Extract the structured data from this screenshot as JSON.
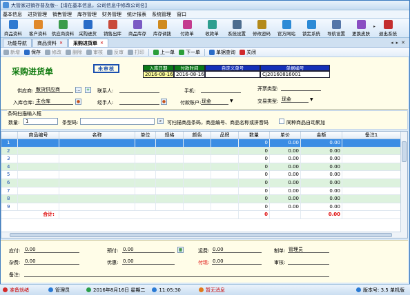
{
  "window": {
    "title": "大管家进销存普及版--【请在基本信息，公司信息中修改公司名】"
  },
  "menu": [
    "基本信息",
    "进货管理",
    "销售管理",
    "库存管理",
    "财务管理",
    "统计报表",
    "系统管理",
    "窗口"
  ],
  "toolbar": [
    {
      "label": "商品资料",
      "icon": "goods-icon",
      "color": "#2f7ad1"
    },
    {
      "label": "客户资料",
      "icon": "customer-icon",
      "color": "#e0892b"
    },
    {
      "label": "供应商资料",
      "icon": "supplier-icon",
      "color": "#3a9b4a"
    },
    {
      "label": "采购进货",
      "icon": "purchase-icon",
      "color": "#2a6cc7"
    },
    {
      "label": "销售出库",
      "icon": "sales-out-icon",
      "color": "#c94a3a"
    },
    {
      "label": "商品库存",
      "icon": "stock-icon",
      "color": "#7b5bc4"
    },
    {
      "label": "库存调拨",
      "icon": "transfer-icon",
      "color": "#d08a1e"
    },
    {
      "label": "付款单",
      "icon": "payment-icon",
      "color": "#c43c8f"
    },
    {
      "label": "收款单",
      "icon": "receipt-icon",
      "color": "#2e9e8f"
    },
    {
      "label": "系统设置",
      "icon": "settings-icon",
      "color": "#4d6d8f"
    },
    {
      "label": "修改密码",
      "icon": "password-icon",
      "color": "#b48a1a"
    },
    {
      "label": "官方网站",
      "icon": "website-icon",
      "color": "#2c8ad6"
    },
    {
      "label": "锁定系统",
      "icon": "lock-icon",
      "color": "#2c8ad6"
    },
    {
      "label": "导航设置",
      "icon": "nav-settings-icon",
      "color": "#5576a8"
    },
    {
      "label": "更换皮肤",
      "icon": "skin-icon",
      "color": "#8a4ec2"
    },
    {
      "label": "退出系统",
      "icon": "exit-icon",
      "color": "#c42e2e"
    }
  ],
  "tabs": [
    {
      "label": "功能导航",
      "active": false
    },
    {
      "label": "商品资料",
      "active": false
    },
    {
      "label": "采购进货单",
      "active": true
    }
  ],
  "actions": [
    {
      "label": "新增",
      "disabled": true,
      "color": "#9ab"
    },
    {
      "label": "保存",
      "disabled": false,
      "color": "#2a6cc7"
    },
    {
      "label": "修改",
      "disabled": true,
      "color": "#9ab"
    },
    {
      "label": "删除",
      "disabled": true,
      "color": "#9ab"
    },
    {
      "label": "审核",
      "disabled": true,
      "color": "#9ab"
    },
    {
      "label": "反审",
      "disabled": true,
      "color": "#9ab"
    },
    {
      "label": "打印",
      "disabled": true,
      "color": "#9ab"
    },
    {
      "label": "上一单",
      "disabled": false,
      "color": "#2a9e3a"
    },
    {
      "label": "下一单",
      "disabled": false,
      "color": "#2a9e3a"
    },
    {
      "label": "单据查询",
      "disabled": false,
      "color": "#2a6cc7"
    },
    {
      "label": "关闭",
      "disabled": false,
      "color": "#d02a2a"
    }
  ],
  "form": {
    "title": "采购进货单",
    "stamp": "未审核",
    "hdr": {
      "labels": [
        "入库日期",
        "付款时间",
        "自定义单号",
        "单据编号"
      ],
      "values": [
        "2016-08-16",
        "2016-08-16",
        "",
        "CJ20160816001"
      ]
    },
    "supplier_label": "供应商:",
    "supplier_value": "散货供应商",
    "contact_label": "联系人:",
    "phone_label": "手机:",
    "invoice_label": "开票类型:",
    "warehouse_label": "入库仓库:",
    "warehouse_value": "主仓库",
    "handler_label": "经手人:",
    "account_label": "付款账户:",
    "account_value": "现金",
    "trade_label": "交易类型:",
    "trade_value": "现金"
  },
  "scan": {
    "legend": "条码扫描输入框",
    "qty_label": "数量:",
    "qty_value": "1",
    "barcode_label": "条型码:",
    "hint": "可扫描商品条码，商品编号、商品名称或拼音码",
    "merge_label": "同种商品自动累加"
  },
  "grid": {
    "headers": [
      "",
      "商品编号",
      "名称",
      "单位",
      "规格",
      "颜色",
      "品牌",
      "数量",
      "单价",
      "金额",
      "备注1"
    ],
    "rows": [
      {
        "n": "1",
        "qty": "0",
        "price": "0.00",
        "amount": "0.00"
      },
      {
        "n": "2",
        "qty": "0",
        "price": "0.00",
        "amount": "0.00"
      },
      {
        "n": "3",
        "qty": "0",
        "price": "0.00",
        "amount": "0.00"
      },
      {
        "n": "4",
        "qty": "0",
        "price": "0.00",
        "amount": "0.00"
      },
      {
        "n": "5",
        "qty": "0",
        "price": "0.00",
        "amount": "0.00"
      },
      {
        "n": "6",
        "qty": "0",
        "price": "0.00",
        "amount": "0.00"
      },
      {
        "n": "7",
        "qty": "0",
        "price": "0.00",
        "amount": "0.00"
      },
      {
        "n": "8",
        "qty": "0",
        "price": "0.00",
        "amount": "0.00"
      },
      {
        "n": "9",
        "qty": "0",
        "price": "0.00",
        "amount": "0.00"
      }
    ],
    "total_label": "合计:",
    "total_qty": "0",
    "total_amount": "0.00"
  },
  "footer": {
    "payable_label": "应付:",
    "payable_value": "0.00",
    "prepay_label": "预付:",
    "prepay_value": "0.00",
    "freight_label": "运费:",
    "freight_value": "0.00",
    "maker_label": "制单:",
    "maker_value": "管理员",
    "misc_label": "杂费:",
    "misc_value": "0.00",
    "discount_label": "优惠:",
    "discount_value": "0.00",
    "paid_label": "付现:",
    "paid_value": "0.00",
    "auditor_label": "审核:",
    "note_label": "备注:"
  },
  "statusbar": {
    "ready": "准备就绪",
    "user": "管理员",
    "datetime": "2016年8月16日 星期二",
    "time": "11:05:30",
    "news": "暂无消息",
    "version": "版本号: 3.5 单机版"
  }
}
